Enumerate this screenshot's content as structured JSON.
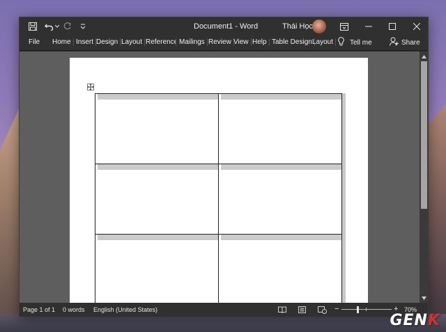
{
  "window": {
    "title": "Document1  -  Word",
    "user": "Thái Học"
  },
  "ribbon": {
    "tabs": [
      "File",
      "Home",
      "Insert",
      "Design",
      "Layout",
      "References",
      "Mailings",
      "Review",
      "View",
      "Help",
      "Table Design",
      "Layout"
    ],
    "tell_me": "Tell me",
    "share": "Share"
  },
  "document": {
    "table": {
      "rows": 3,
      "cols": 2
    }
  },
  "statusbar": {
    "page": "Page 1 of 1",
    "words": "0 words",
    "language": "English (United States)",
    "zoom_out": "−",
    "zoom_in": "+",
    "zoom": "70%"
  },
  "watermark": {
    "text": "GEN",
    "accent": "K"
  },
  "colors": {
    "window_chrome": "#303030",
    "workspace": "#5e5e5e",
    "page": "#ffffff",
    "cell_band": "#cbcbcb",
    "watermark_accent": "#d2322d"
  },
  "icons": [
    "save-icon",
    "undo-icon",
    "redo-icon",
    "customize-icon",
    "ribbon-display-icon",
    "minimize-icon",
    "maximize-icon",
    "close-icon",
    "lightbulb-icon",
    "share-person-icon",
    "read-mode-icon",
    "print-layout-icon",
    "web-layout-icon",
    "table-move-icon"
  ]
}
